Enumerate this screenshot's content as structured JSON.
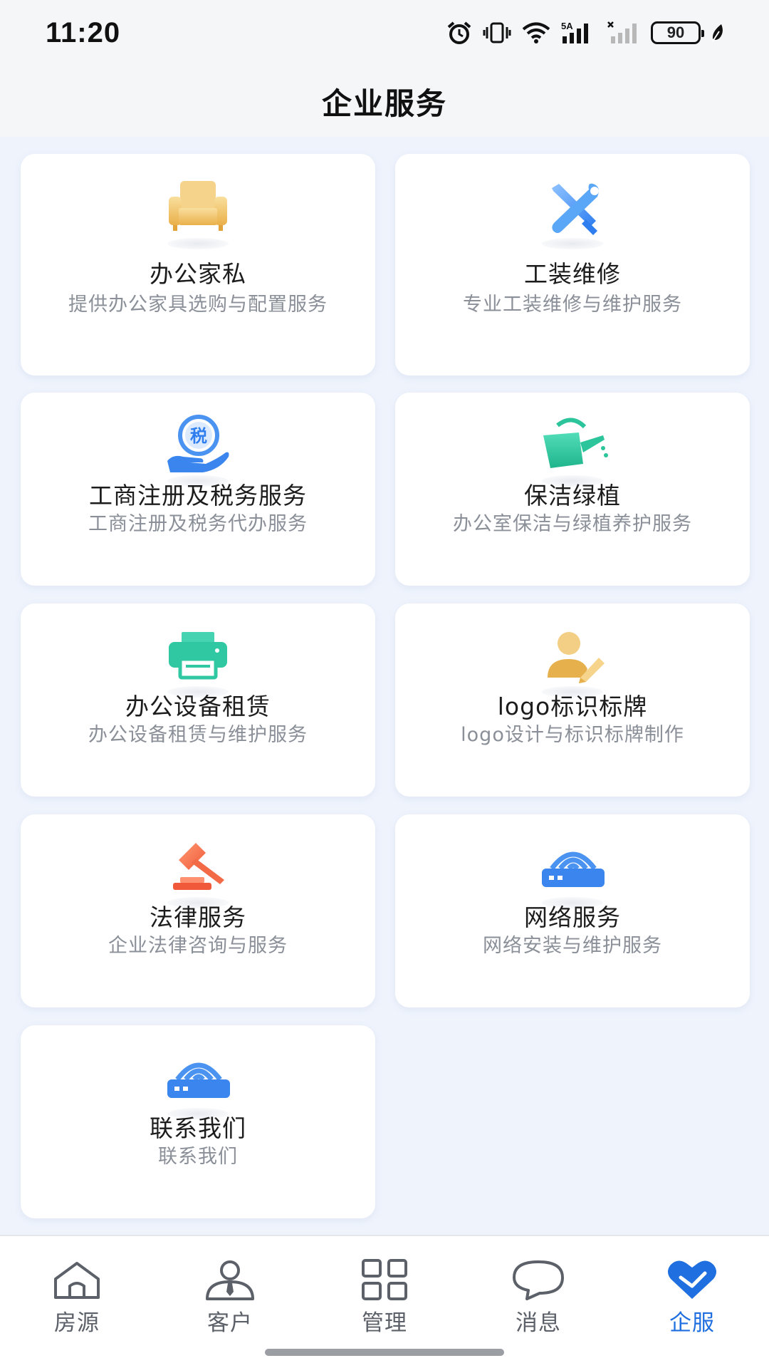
{
  "status_bar": {
    "time": "11:20",
    "network": "5A",
    "battery": "90",
    "icons": [
      "alarm-icon",
      "vibrate-icon",
      "wifi-icon",
      "signal-icon",
      "no-signal-icon",
      "battery-icon",
      "leaf-icon"
    ]
  },
  "header": {
    "title": "企业服务"
  },
  "services": [
    {
      "title": "办公家私",
      "desc": "提供办公家具选购与配置服务",
      "icon": "sofa-icon"
    },
    {
      "title": "工装维修",
      "desc": "专业工装维修与维护服务",
      "icon": "tools-icon"
    },
    {
      "title": "工商注册及税务服务",
      "desc": "工商注册及税务代办服务",
      "icon": "tax-hand-icon",
      "icon_text": "税"
    },
    {
      "title": "保洁绿植",
      "desc": "办公室保洁与绿植养护服务",
      "icon": "watering-can-icon"
    },
    {
      "title": "办公设备租赁",
      "desc": "办公设备租赁与维护服务",
      "icon": "printer-icon"
    },
    {
      "title": "logo标识标牌",
      "desc": "logo设计与标识标牌制作",
      "icon": "user-edit-icon"
    },
    {
      "title": "法律服务",
      "desc": "企业法律咨询与服务",
      "icon": "gavel-icon"
    },
    {
      "title": "网络服务",
      "desc": "网络安装与维护服务",
      "icon": "router-icon"
    },
    {
      "title": "联系我们",
      "desc": "联系我们",
      "icon": "router-icon"
    }
  ],
  "bottom_nav": [
    {
      "label": "房源",
      "icon": "house-icon",
      "active": false
    },
    {
      "label": "客户",
      "icon": "customer-icon",
      "active": false
    },
    {
      "label": "管理",
      "icon": "grid-icon",
      "active": false
    },
    {
      "label": "消息",
      "icon": "chat-bubble-icon",
      "active": false
    },
    {
      "label": "企服",
      "icon": "heart-icon",
      "active": true
    }
  ],
  "colors": {
    "accent": "#1f6fe0",
    "content_bg": "#eef3fc",
    "nav_inactive": "#5c6068",
    "desc_text": "#8a8f98"
  }
}
